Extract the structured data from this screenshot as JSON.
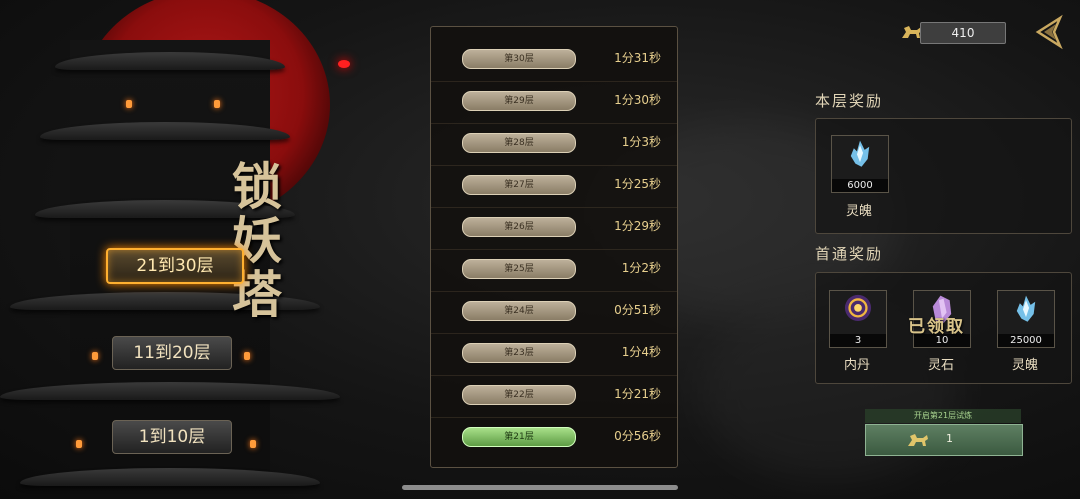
{
  "currency": {
    "icon": "horse-icon",
    "amount": "410"
  },
  "tower": {
    "title": "锁妖塔",
    "ranges": [
      {
        "label": "21到30层",
        "active": true
      },
      {
        "label": "11到20层",
        "active": false
      },
      {
        "label": "1到10层",
        "active": false
      }
    ]
  },
  "floors": [
    {
      "label": "第30层",
      "time": "1分31秒",
      "current": false
    },
    {
      "label": "第29层",
      "time": "1分30秒",
      "current": false
    },
    {
      "label": "第28层",
      "time": "1分3秒",
      "current": false
    },
    {
      "label": "第27层",
      "time": "1分25秒",
      "current": false
    },
    {
      "label": "第26层",
      "time": "1分29秒",
      "current": false
    },
    {
      "label": "第25层",
      "time": "1分2秒",
      "current": false
    },
    {
      "label": "第24层",
      "time": "0分51秒",
      "current": false
    },
    {
      "label": "第23层",
      "time": "1分4秒",
      "current": false
    },
    {
      "label": "第22层",
      "time": "1分21秒",
      "current": false
    },
    {
      "label": "第21层",
      "time": "0分56秒",
      "current": true
    }
  ],
  "floor_reward": {
    "title": "本层奖励",
    "items": [
      {
        "name": "灵魄",
        "count": "6000",
        "icon": "blue-crystal-icon"
      }
    ]
  },
  "first_clear_reward": {
    "title": "首通奖励",
    "claimed_text": "已领取",
    "items": [
      {
        "name": "内丹",
        "count": "3",
        "icon": "golden-orb-icon"
      },
      {
        "name": "灵石",
        "count": "10",
        "icon": "purple-stone-icon"
      },
      {
        "name": "灵魄",
        "count": "25000",
        "icon": "blue-crystal-icon"
      }
    ]
  },
  "challenge": {
    "label": "开启第21层试炼",
    "cost": "1",
    "cost_icon": "horse-icon"
  }
}
